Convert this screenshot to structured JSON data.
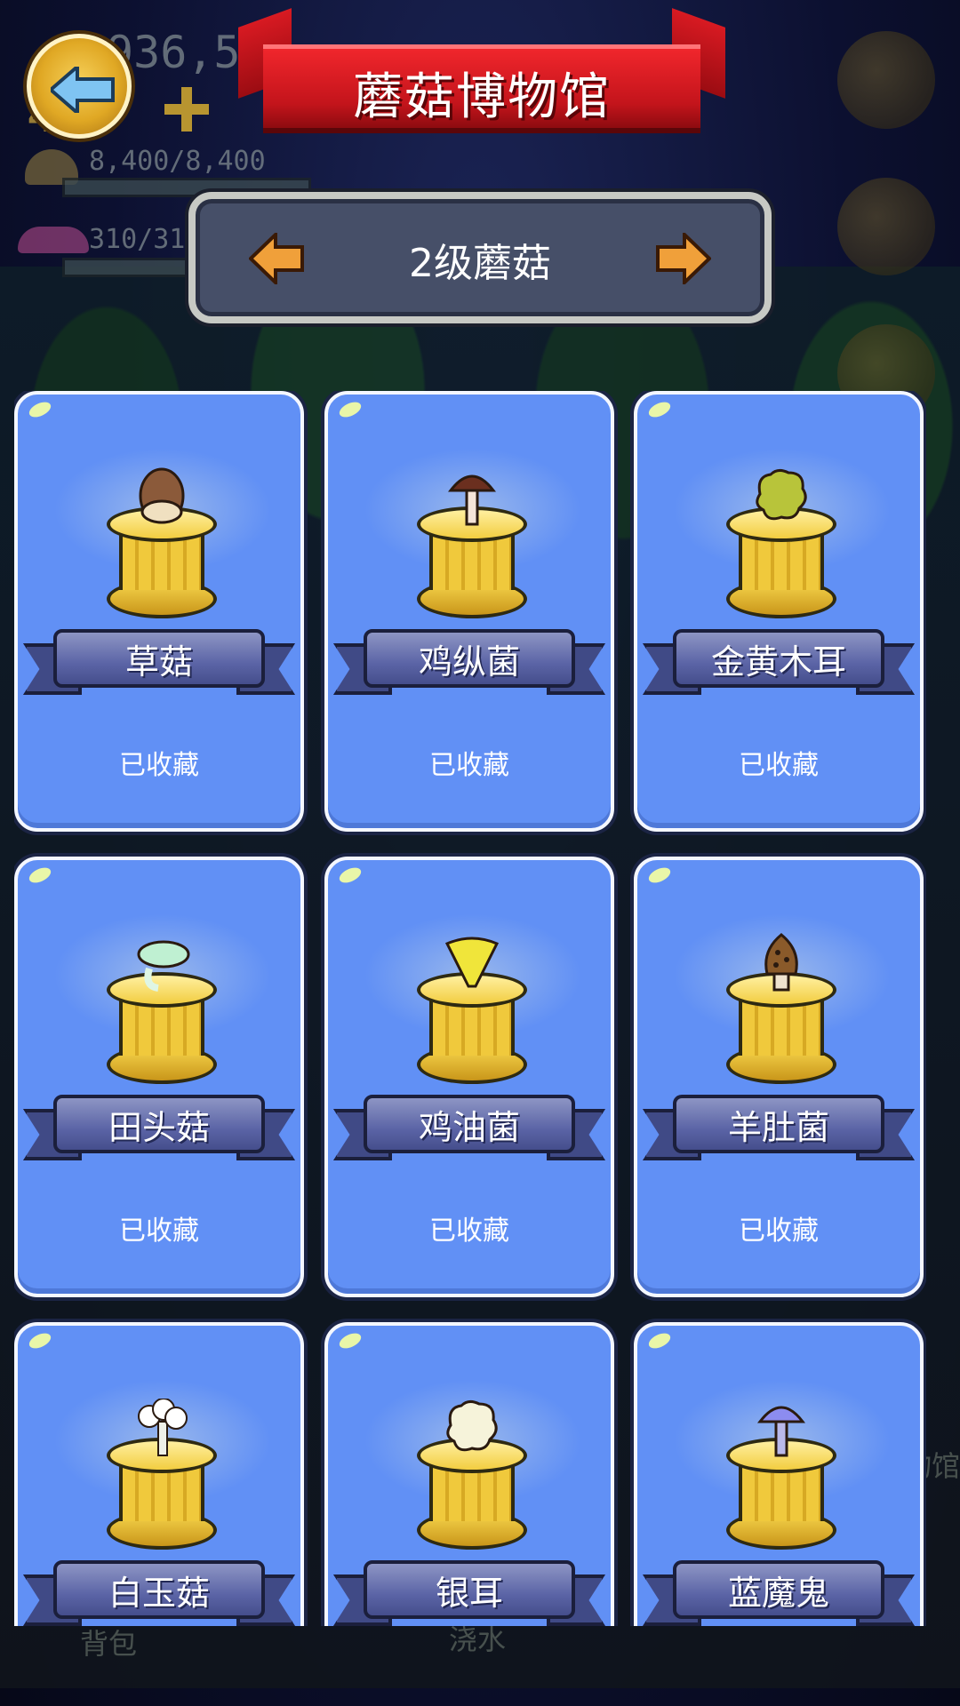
{
  "hud": {
    "gold": "936,56",
    "level_num": "4",
    "stat1": "8,400/8,400",
    "stat2": "310/31"
  },
  "header": {
    "title": "蘑菇博物馆",
    "back_icon": "arrow-left-icon"
  },
  "level_selector": {
    "label": "2级蘑菇",
    "prev_icon": "arrow-left-icon",
    "next_icon": "arrow-right-icon"
  },
  "mushrooms": [
    {
      "name": "草菇",
      "status": "已收藏",
      "cap": "#8b5a3a",
      "stem": "#f0e0c0",
      "shape": "egg"
    },
    {
      "name": "鸡纵菌",
      "status": "已收藏",
      "cap": "#6b2f1f",
      "stem": "#f4e4d8",
      "shape": "tall"
    },
    {
      "name": "金黄木耳",
      "status": "已收藏",
      "cap": "#b8c43a",
      "stem": "#b8c43a",
      "shape": "blob"
    },
    {
      "name": "田头菇",
      "status": "已收藏",
      "cap": "#bff0d2",
      "stem": "#dff6e4",
      "shape": "flat"
    },
    {
      "name": "鸡油菌",
      "status": "已收藏",
      "cap": "#f0e53a",
      "stem": "#d9c02a",
      "shape": "funnel"
    },
    {
      "name": "羊肚菌",
      "status": "已收藏",
      "cap": "#8a5a2a",
      "stem": "#f0e3cf",
      "shape": "morel"
    },
    {
      "name": "白玉菇",
      "status": "",
      "cap": "#ffffff",
      "stem": "#eef0e8",
      "shape": "cluster"
    },
    {
      "name": "银耳",
      "status": "",
      "cap": "#f6f3da",
      "stem": "#f6f3da",
      "shape": "blob"
    },
    {
      "name": "蓝魔鬼",
      "status": "",
      "cap": "#8c8cf0",
      "stem": "#b9b9ea",
      "shape": "tall"
    }
  ],
  "bottom_nav": {
    "bag": "背包",
    "water": "浇水",
    "museum": "物馆"
  },
  "colors": {
    "card_bg": "#6190f5",
    "banner_red": "#d81a22",
    "ribbon": "#5b64a6",
    "pedestal": "#f0c93c"
  }
}
